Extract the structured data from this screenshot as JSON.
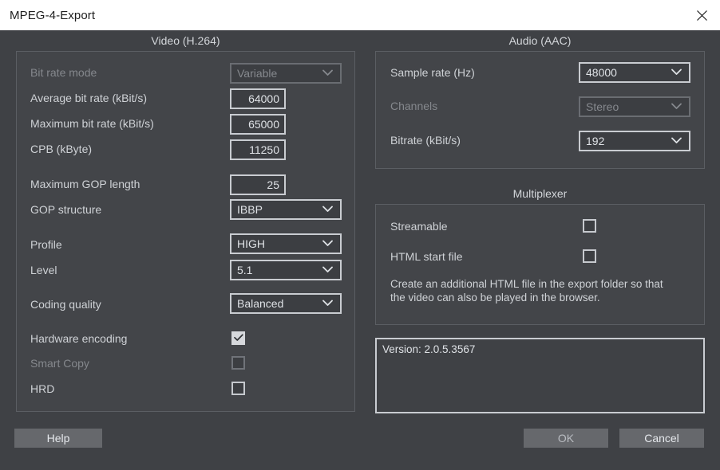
{
  "window": {
    "title": "MPEG-4-Export",
    "close_icon": "close-icon"
  },
  "video": {
    "group_title": "Video (H.264)",
    "bit_rate_mode": {
      "label": "Bit rate mode",
      "value": "Variable",
      "disabled": true
    },
    "average_bit_rate": {
      "label": "Average bit rate (kBit/s)",
      "value": "64000"
    },
    "maximum_bit_rate": {
      "label": "Maximum bit rate (kBit/s)",
      "value": "65000"
    },
    "cpb": {
      "label": "CPB (kByte)",
      "value": "11250"
    },
    "maximum_gop_length": {
      "label": "Maximum GOP length",
      "value": "25"
    },
    "gop_structure": {
      "label": "GOP structure",
      "value": "IBBP"
    },
    "profile": {
      "label": "Profile",
      "value": "HIGH"
    },
    "level": {
      "label": "Level",
      "value": "5.1"
    },
    "coding_quality": {
      "label": "Coding quality",
      "value": "Balanced"
    },
    "hardware_encoding": {
      "label": "Hardware encoding",
      "checked": true
    },
    "smart_copy": {
      "label": "Smart Copy",
      "checked": false,
      "disabled": true
    },
    "hrd": {
      "label": "HRD",
      "checked": false
    }
  },
  "audio": {
    "group_title": "Audio (AAC)",
    "sample_rate": {
      "label": "Sample rate (Hz)",
      "value": "48000"
    },
    "channels": {
      "label": "Channels",
      "value": "Stereo",
      "disabled": true
    },
    "bitrate": {
      "label": "Bitrate (kBit/s)",
      "value": "192"
    }
  },
  "multiplexer": {
    "group_title": "Multiplexer",
    "streamable": {
      "label": "Streamable",
      "checked": false
    },
    "html_start_file": {
      "label": "HTML start file",
      "checked": false
    },
    "description": "Create an additional HTML file in the export folder so that the video can also be played in the browser."
  },
  "version": {
    "text": "Version: 2.0.5.3567"
  },
  "buttons": {
    "help": "Help",
    "ok": "OK",
    "cancel": "Cancel"
  },
  "colors": {
    "dialog_background": "#3f4145",
    "titlebar_background": "#ffffff",
    "field_border": "#c9ccd1",
    "button_face": "#66686c",
    "text": "#cfd2d6",
    "text_disabled": "#86898e"
  }
}
